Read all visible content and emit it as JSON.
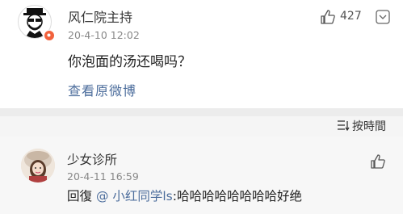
{
  "comment": {
    "username": "风仁院主持",
    "timestamp": "20-4-10 12:02",
    "text": "你泡面的汤还喝吗？",
    "like_count": "427",
    "view_original_link": "查看原微博"
  },
  "sort": {
    "label": "按時間"
  },
  "reply": {
    "username": "少女诊所",
    "timestamp": "20-4-11 16:59",
    "prefix": "回復",
    "mention": "@ 小红同学ls",
    "text": ":哈哈哈哈哈哈哈哈好绝"
  },
  "colors": {
    "link": "#4c6d9c",
    "badge": "#f2623d",
    "background": "#f2f2f2"
  }
}
